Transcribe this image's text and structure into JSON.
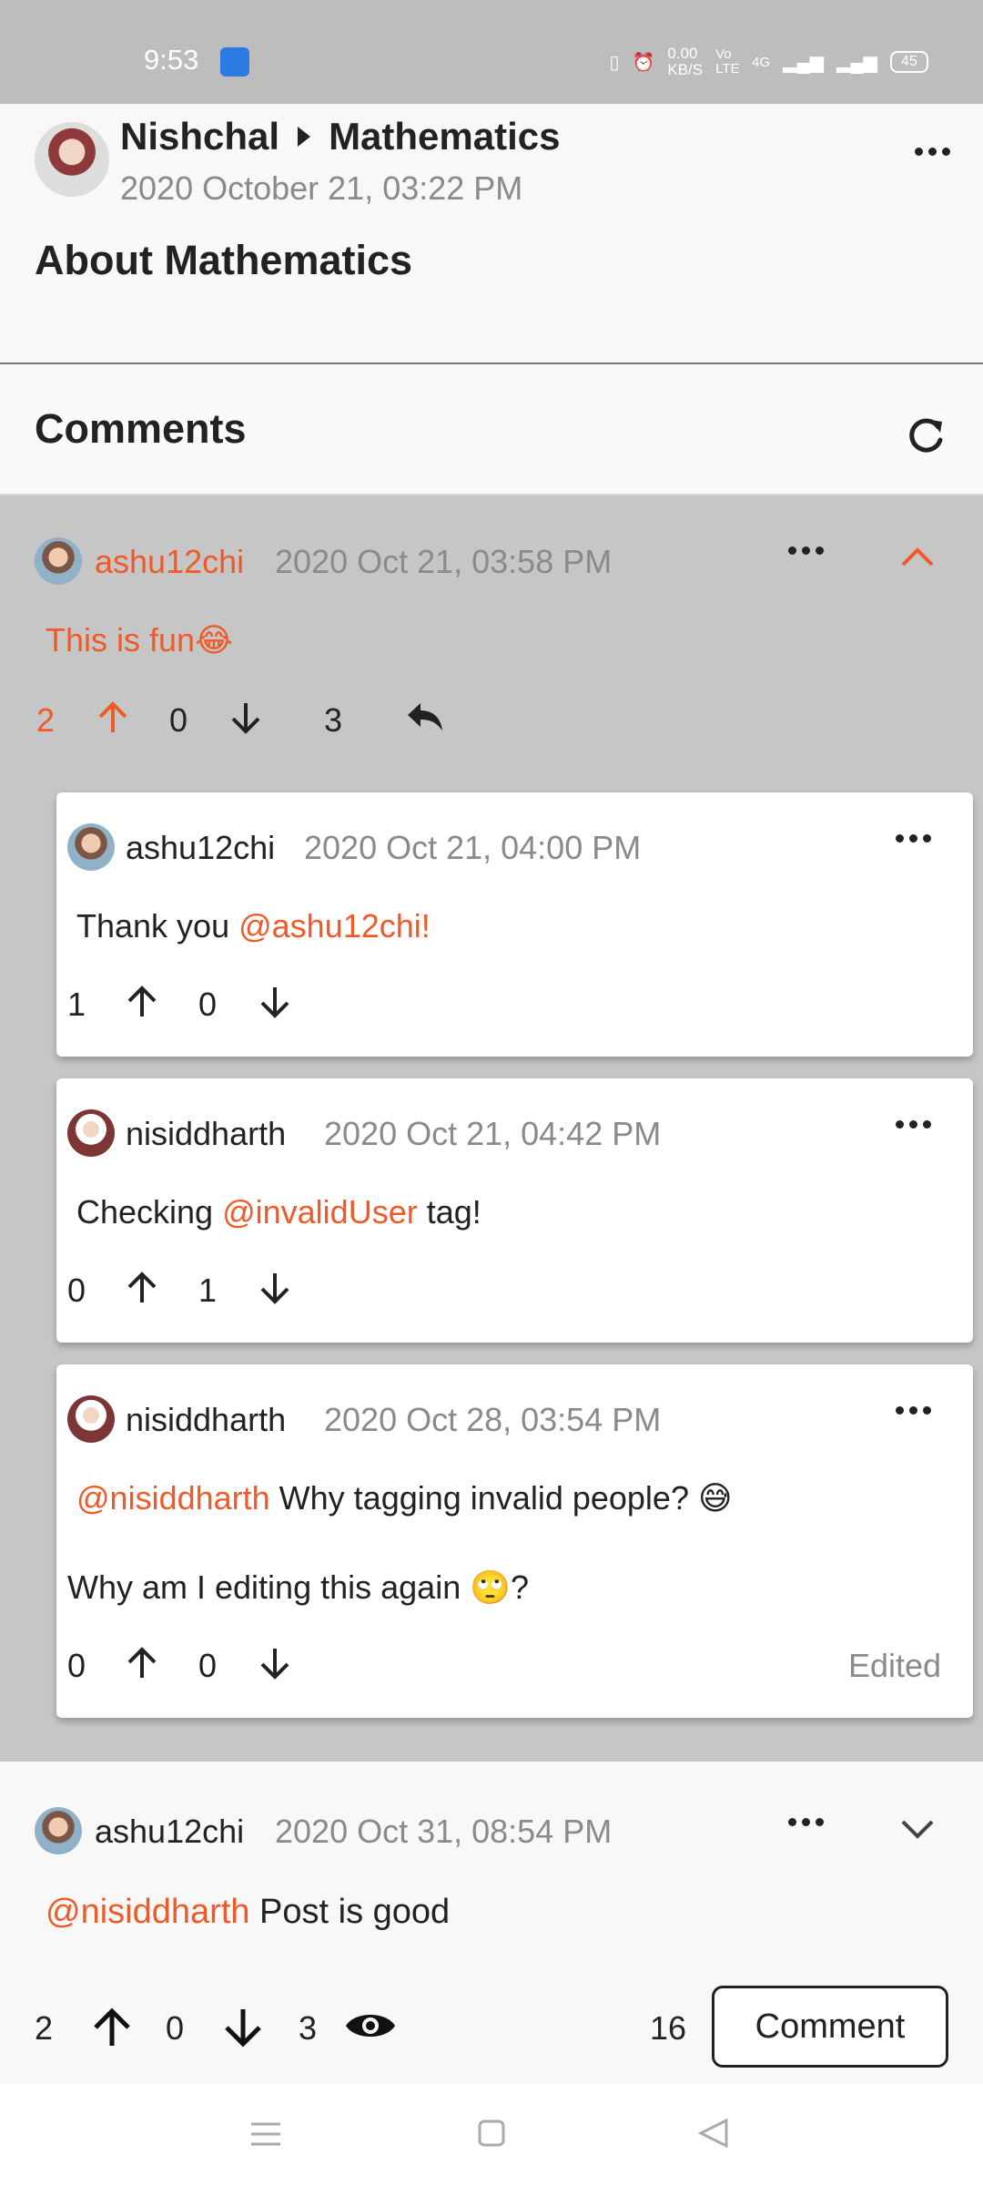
{
  "status_bar": {
    "time": "9:53",
    "speed_value": "0.00",
    "speed_unit": "KB/S",
    "network_volte": "Vo LTE",
    "network_4g": "4G",
    "battery": "45"
  },
  "post": {
    "author": "Nishchal",
    "category": "Mathematics",
    "date": "2020 October 21, 03:22 PM",
    "title": "About Mathematics"
  },
  "comments_section": {
    "title": "Comments"
  },
  "thread": {
    "user": "ashu12chi",
    "date": "2020 Oct 21, 03:58 PM",
    "text": "This is fun😂",
    "upvotes": "2",
    "downvotes": "0",
    "replies": "3"
  },
  "replies": [
    {
      "user": "ashu12chi",
      "date": "2020 Oct 21, 04:00 PM",
      "text_prefix": "Thank you ",
      "mention": "@ashu12chi!",
      "text_suffix": "",
      "upvotes": "1",
      "downvotes": "0"
    },
    {
      "user": "nisiddharth",
      "date": "2020 Oct 21, 04:42 PM",
      "text_prefix": "Checking ",
      "mention": "@invalidUser",
      "text_suffix": " tag!",
      "upvotes": "0",
      "downvotes": "1"
    },
    {
      "user": "nisiddharth",
      "date": "2020 Oct 28, 03:54 PM",
      "mention": "@nisiddharth",
      "text_suffix": " Why tagging invalid people? 😅",
      "text_line2": "Why am I editing this again 🙄?",
      "upvotes": "0",
      "downvotes": "0",
      "edited_label": "Edited"
    }
  ],
  "last_comment": {
    "user": "ashu12chi",
    "date": "2020 Oct 31, 08:54 PM",
    "mention": "@nisiddharth",
    "text_suffix": " Post is good"
  },
  "post_footer": {
    "upvotes": "2",
    "downvotes": "0",
    "views": "3",
    "comment_count": "16",
    "comment_button": "Comment"
  },
  "colors": {
    "accent": "#f05a28",
    "thread_bg": "#c6c6c6"
  },
  "icons": [
    "more-icon",
    "refresh-icon",
    "chevron-up-icon",
    "chevron-down-icon",
    "arrow-up-icon",
    "arrow-down-icon",
    "reply-icon",
    "eye-icon"
  ]
}
